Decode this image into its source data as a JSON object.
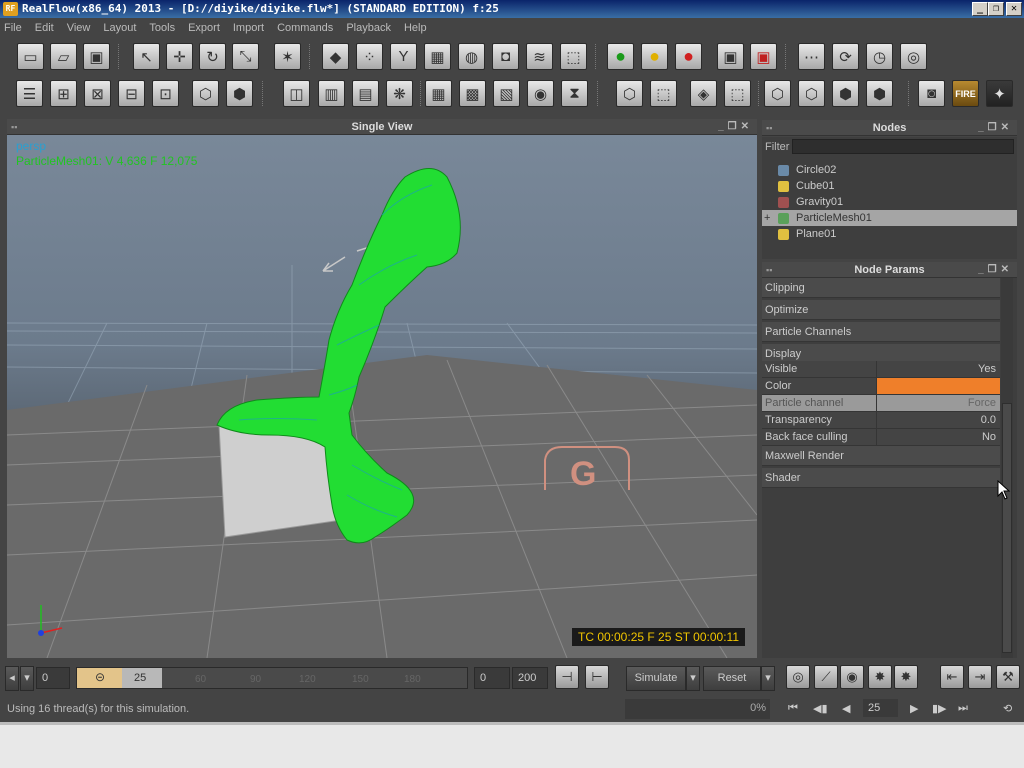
{
  "window": {
    "title": "RealFlow(x86_64) 2013 - [D://diyike/diyike.flw*] (STANDARD EDITION) f:25",
    "logo": "RF",
    "min": "_",
    "max": "❐",
    "close": "✕"
  },
  "menu": [
    "File",
    "Edit",
    "View",
    "Layout",
    "Tools",
    "Export",
    "Import",
    "Commands",
    "Playback",
    "Help"
  ],
  "toolbar_badges": {
    "fire": "FIRE"
  },
  "viewport": {
    "title": "Single View",
    "camera": "persp",
    "stats": "ParticleMesh01: V 4,636 F 12,075",
    "timecode": "TC 00:00:25   F 25   ST 00:00:11",
    "floor_label": "G"
  },
  "nodes": {
    "title": "Nodes",
    "filter_label": "Filter",
    "filter_value": "",
    "items": [
      {
        "name": "Circle02",
        "icon": "emitter-icon",
        "color": "#6a8aa8"
      },
      {
        "name": "Cube01",
        "icon": "cube-icon",
        "color": "#e0c040"
      },
      {
        "name": "Gravity01",
        "icon": "daemon-icon",
        "color": "#a05050"
      },
      {
        "name": "ParticleMesh01",
        "icon": "mesh-icon",
        "color": "#5aa05a"
      },
      {
        "name": "Plane01",
        "icon": "plane-icon",
        "color": "#e0c040"
      }
    ],
    "selected": "ParticleMesh01",
    "expand_glyph": "+"
  },
  "params": {
    "title": "Node Params",
    "sections_top": [
      "Clipping",
      "Optimize",
      "Particle Channels",
      "Display"
    ],
    "rows": [
      {
        "label": "Visible",
        "value": "Yes"
      },
      {
        "label": "Color",
        "value": ""
      },
      {
        "label": "Particle channel",
        "value": "Force"
      },
      {
        "label": "Transparency",
        "value": "0.0"
      },
      {
        "label": "Back face culling",
        "value": "No"
      }
    ],
    "sections_bottom": [
      "Maxwell Render",
      "Shader"
    ],
    "color_swatch": "#ef7f2a"
  },
  "timeline": {
    "start": "0",
    "range_end": "25",
    "ticks": [
      "60",
      "90",
      "120",
      "150",
      "180"
    ],
    "min_frame": "0",
    "max_frame": "200",
    "simulate_label": "Simulate",
    "reset_label": "Reset"
  },
  "status": {
    "message": "Using 16 thread(s) for this simulation.",
    "progress": "0%",
    "progress_value": 0,
    "frame": "25"
  },
  "playback": [
    "⏮",
    "◀▮",
    "◀",
    "▶",
    "▮▶",
    "⏭",
    "⟲"
  ]
}
